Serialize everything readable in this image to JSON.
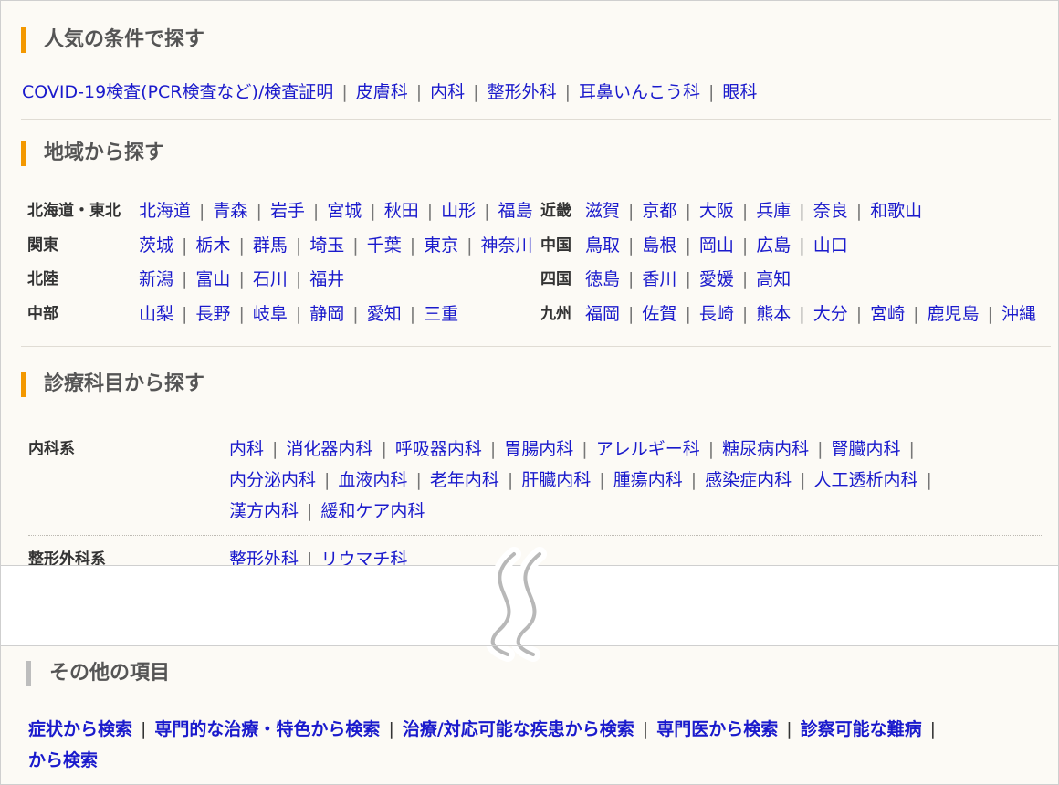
{
  "popular": {
    "title": "人気の条件で探す",
    "links": [
      "COVID-19検査(PCR検査など)/検査証明",
      "皮膚科",
      "内科",
      "整形外科",
      "耳鼻いんこう科",
      "眼科"
    ]
  },
  "region": {
    "title": "地域から探す",
    "left": [
      {
        "label": "北海道・東北",
        "items": [
          "北海道",
          "青森",
          "岩手",
          "宮城",
          "秋田",
          "山形",
          "福島"
        ]
      },
      {
        "label": "関東",
        "items": [
          "茨城",
          "栃木",
          "群馬",
          "埼玉",
          "千葉",
          "東京",
          "神奈川"
        ]
      },
      {
        "label": "北陸",
        "items": [
          "新潟",
          "富山",
          "石川",
          "福井"
        ]
      },
      {
        "label": "中部",
        "items": [
          "山梨",
          "長野",
          "岐阜",
          "静岡",
          "愛知",
          "三重"
        ]
      }
    ],
    "right": [
      {
        "label": "近畿",
        "items": [
          "滋賀",
          "京都",
          "大阪",
          "兵庫",
          "奈良",
          "和歌山"
        ]
      },
      {
        "label": "中国",
        "items": [
          "鳥取",
          "島根",
          "岡山",
          "広島",
          "山口"
        ]
      },
      {
        "label": "四国",
        "items": [
          "徳島",
          "香川",
          "愛媛",
          "高知"
        ]
      },
      {
        "label": "九州",
        "items": [
          "福岡",
          "佐賀",
          "長崎",
          "熊本",
          "大分",
          "宮崎",
          "鹿児島",
          "沖縄"
        ]
      }
    ]
  },
  "specialty": {
    "title": "診療科目から探す",
    "groups": [
      {
        "label": "内科系",
        "lines": [
          {
            "items": [
              "内科",
              "消化器内科",
              "呼吸器内科",
              "胃腸内科",
              "アレルギー科",
              "糖尿病内科",
              "腎臓内科"
            ],
            "trailing_bar": true
          },
          {
            "items": [
              "内分泌内科",
              "血液内科",
              "老年内科",
              "肝臓内科",
              "腫瘍内科",
              "感染症内科",
              "人工透析内科"
            ],
            "trailing_bar": true
          },
          {
            "items": [
              "漢方内科",
              "緩和ケア内科"
            ],
            "trailing_bar": false
          }
        ]
      },
      {
        "label": "整形外科系",
        "lines": [
          {
            "items": [
              "整形外科",
              "リウマチ科"
            ],
            "trailing_bar": false
          }
        ]
      }
    ]
  },
  "other": {
    "title": "その他の項目",
    "line1": [
      "症状から検索",
      "専門的な治療・特色から検索",
      "治療/対応可能な疾患から検索",
      "専門医から検索",
      "診察可能な難病"
    ],
    "line2": [
      "から検索"
    ]
  },
  "colors": {
    "accent": "#f39800",
    "link": "#1a1acc",
    "muted_bar": "#bdbdbd",
    "background": "#fcfaf5"
  },
  "icons": {
    "break": "wavy-break-icon"
  }
}
